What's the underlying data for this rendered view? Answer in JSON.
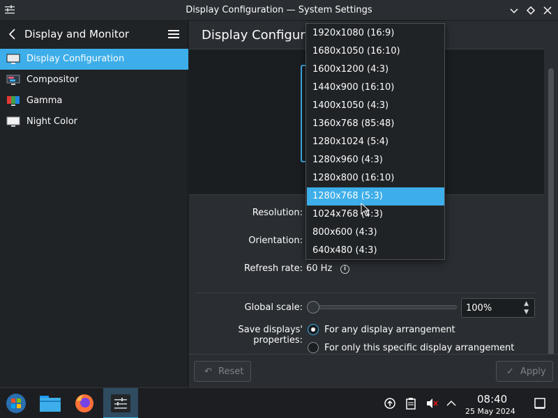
{
  "window": {
    "title": "Display Configuration — System Settings"
  },
  "sidebar": {
    "header": "Display and Monitor",
    "items": [
      {
        "label": "Display Configuration",
        "icon": "monitor-icon",
        "active": true
      },
      {
        "label": "Compositor",
        "icon": "compositor-icon",
        "active": false
      },
      {
        "label": "Gamma",
        "icon": "gamma-icon",
        "active": false
      },
      {
        "label": "Night Color",
        "icon": "night-color-icon",
        "active": false
      }
    ]
  },
  "main": {
    "title": "Display Configuration",
    "resolution_label": "Resolution:",
    "orientation_label": "Orientation:",
    "refresh_label": "Refresh rate:",
    "refresh_value": "60 Hz",
    "global_scale_label": "Global scale:",
    "global_scale_value": "100%",
    "global_scale_fraction": 0.0,
    "save_label": "Save displays' properties:",
    "save_options": [
      {
        "label": "For any display arrangement",
        "checked": true
      },
      {
        "label": "For only this specific display arrangement",
        "checked": false
      }
    ],
    "reset_label": "Reset",
    "apply_label": "Apply"
  },
  "resolution_dropdown": {
    "selected_index": 9,
    "options": [
      "1920x1080 (16:9)",
      "1680x1050 (16:10)",
      "1600x1200 (4:3)",
      "1440x900 (16:10)",
      "1400x1050 (4:3)",
      "1360x768 (85:48)",
      "1280x1024 (5:4)",
      "1280x960 (4:3)",
      "1280x800 (16:10)",
      "1280x768 (5:3)",
      "1024x768 (4:3)",
      "800x600 (4:3)",
      "640x480 (4:3)"
    ]
  },
  "taskbar": {
    "apps": [
      "start-menu-icon",
      "file-manager-icon",
      "firefox-icon",
      "system-settings-icon"
    ],
    "tray": [
      "updates-icon",
      "clipboard-icon",
      "volume-muted-icon",
      "tray-expand-icon"
    ],
    "time": "08:40",
    "date": "25 May 2024"
  },
  "colors": {
    "accent": "#3daee9",
    "window_bg": "#2a2e32",
    "sidebar_bg": "#202326"
  }
}
